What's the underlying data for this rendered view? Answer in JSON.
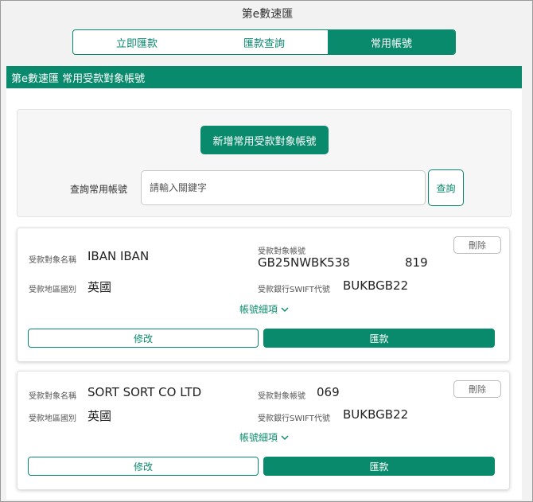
{
  "app": {
    "title": "第e數速匯"
  },
  "tabs": [
    {
      "label": "立即匯款",
      "active": false
    },
    {
      "label": "匯款查詢",
      "active": false
    },
    {
      "label": "常用帳號",
      "active": true
    }
  ],
  "panel": {
    "header": "第e數速匯 常用受款對象帳號"
  },
  "search": {
    "add_button": "新增常用受款對象帳號",
    "label": "查詢常用帳號",
    "placeholder": "請輸入關鍵字",
    "value": "",
    "button": "查詢"
  },
  "labels": {
    "payee_name": "受款對象名稱",
    "account_no": "受款對象帳號",
    "region": "受款地區國別",
    "swift": "受款銀行SWIFT代號",
    "delete": "刪除",
    "details": "帳號細項",
    "edit": "修改",
    "remit": "匯款"
  },
  "accounts": [
    {
      "payee_name": "IBAN IBAN",
      "account_no_start": "GB25NWBK538",
      "account_no_end": "819",
      "region": "英國",
      "swift": "BUKBGB22"
    },
    {
      "payee_name": "SORT SORT CO LTD",
      "account_no_start": "069",
      "account_no_end": "",
      "region": "英國",
      "swift": "BUKBGB22"
    }
  ],
  "colors": {
    "accent": "#0a8a6c",
    "background": "#f2f2f2"
  }
}
